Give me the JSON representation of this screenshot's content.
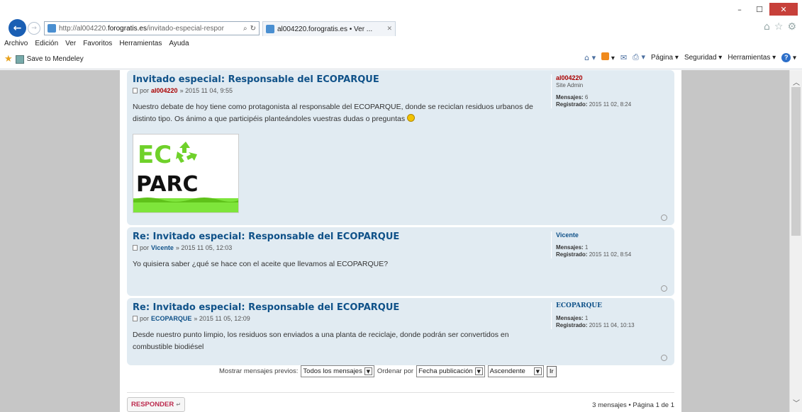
{
  "browser": {
    "address_prefix": "http://al004220.",
    "address_host": "forogratis.es",
    "address_path": "/invitado-especial-respor",
    "tab_title": "al004220.forogratis.es • Ver ...",
    "menu": [
      "Archivo",
      "Edición",
      "Ver",
      "Favoritos",
      "Herramientas",
      "Ayuda"
    ],
    "favorite": "Save to Mendeley",
    "commands": [
      "Página",
      "Seguridad",
      "Herramientas"
    ]
  },
  "posts": [
    {
      "title": "Invitado especial: Responsable del ECOPARQUE",
      "by": "por",
      "author": "al004220",
      "date": "» 2015 11 04, 9:55",
      "content": "Nuestro debate de hoy tiene como protagonista al responsable del ECOPARQUE, donde se reciclan residuos urbanos de distinto tipo. Os ánimo a que participéis planteándoles vuestras dudas o preguntas",
      "profile": {
        "name": "al004220",
        "rank": "Site Admin",
        "messages_label": "Mensajes:",
        "messages": "6",
        "registered_label": "Registrado:",
        "registered": "2015 11 02, 8:24"
      },
      "logo_text_1": "EC",
      "logo_text_2": "PARC"
    },
    {
      "title": "Re: Invitado especial: Responsable del ECOPARQUE",
      "by": "por",
      "author": "Vicente",
      "date": "» 2015 11 05, 12:03",
      "content": "Yo quisiera saber ¿qué se hace con el aceite que llevamos al ECOPARQUE?",
      "profile": {
        "name": "Vicente",
        "messages_label": "Mensajes:",
        "messages": "1",
        "registered_label": "Registrado:",
        "registered": "2015 11 02, 8:54"
      }
    },
    {
      "title": "Re: Invitado especial: Responsable del ECOPARQUE",
      "by": "por",
      "author": "ECOPARQUE",
      "date": "» 2015 11 05, 12:09",
      "content": "Desde nuestro punto limpio, los residuos son enviados a una planta de reciclaje, donde podrán ser convertidos en combustible biodiésel",
      "profile": {
        "name": "ECOPARQUE",
        "messages_label": "Mensajes:",
        "messages": "1",
        "registered_label": "Registrado:",
        "registered": "2015 11 04, 10:13"
      }
    }
  ],
  "sort": {
    "show_label": "Mostrar mensajes previos:",
    "show_value": "Todos los mensajes",
    "order_label": "Ordenar por",
    "order_value": "Fecha publicación",
    "direction_value": "Ascendente",
    "go_label": "Ir"
  },
  "footer": {
    "reply_label": "RESPONDER",
    "pagination": "3 mensajes • Página 1 de 1"
  },
  "colors": {
    "post_bg": "#e1ebf2",
    "title": "#105289",
    "admin_name": "#aa0000"
  }
}
